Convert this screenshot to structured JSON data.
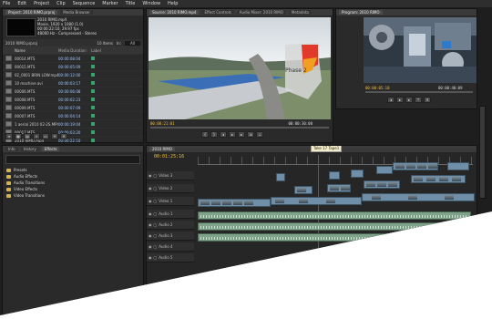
{
  "menu": [
    "File",
    "Edit",
    "Project",
    "Clip",
    "Sequence",
    "Marker",
    "Title",
    "Window",
    "Help"
  ],
  "project": {
    "tabs": [
      "Project: 2010 RIMO.prproj",
      "Media Browser"
    ],
    "clip_name": "2010 RIMO.mp4",
    "clip_info": [
      "Movie, 1920 x 1080 (1.0)",
      "00:00:22:10, 29.97 fps",
      "48000 Hz - Compressed - Stereo"
    ],
    "bin_label": "2010 RIMO.prproj",
    "items_count": "10 Items",
    "search_label": "In:",
    "search_value": "All",
    "col_name": "Name",
    "col_duration": "Media Duration",
    "col_label": "Label",
    "items": [
      {
        "name": "00014.MTS",
        "duration": "00:00:08:04"
      },
      {
        "name": "00015.MTS",
        "duration": "00:00:05:09"
      },
      {
        "name": "02_0001 BRIN LOW.mp4",
        "duration": "00:00:12:00"
      },
      {
        "name": "10 machine.avi",
        "duration": "00:00:03:17"
      },
      {
        "name": "00006.MTS",
        "duration": "00:00:06:08"
      },
      {
        "name": "00008.MTS",
        "duration": "00:00:02:23"
      },
      {
        "name": "00009.MTS",
        "duration": "00:00:07:09"
      },
      {
        "name": "00007.MTS",
        "duration": "00:00:04:14"
      },
      {
        "name": "1 aerial 2010 02-2S.MP4",
        "duration": "00:00:19:04"
      },
      {
        "name": "00017.MTS",
        "duration": "00:00:03:20"
      },
      {
        "name": "2010 RIMO.mp4",
        "duration": "00:00:22:10"
      }
    ]
  },
  "effects": {
    "tabs": [
      "Info",
      "History",
      "Effects"
    ],
    "folders": [
      "Presets",
      "Audio Effects",
      "Audio Transitions",
      "Video Effects",
      "Video Transitions"
    ]
  },
  "source": {
    "tabs": [
      "Source: 2010 RIMO.mp4",
      "Effect Controls",
      "Audio Mixer: 2010 RIMO",
      "Metadata"
    ],
    "timecode_left": "00:00:21:01",
    "timecode_right": "00:00:30:00",
    "overlay_label": "Phase 2"
  },
  "program": {
    "tabs": [
      "Program: 2010 RIMO"
    ],
    "timecode_left": "00:00:05:10",
    "timecode_right": "00:00:40:09"
  },
  "timeline": {
    "tabs": [
      "2010 RIMO"
    ],
    "timecode": "00:01:25:16",
    "marker_label": "Take 17 Tape1",
    "tracks": [
      "Video 3",
      "Video 2",
      "Video 1",
      "Audio 1",
      "Audio 2",
      "Audio 3",
      "Audio 4",
      "Audio 5"
    ]
  },
  "colors": {
    "timecode": "#f0c040",
    "label_green": "#36a36a",
    "folder": "#d6b24a",
    "timeline_bg": "#262626"
  }
}
